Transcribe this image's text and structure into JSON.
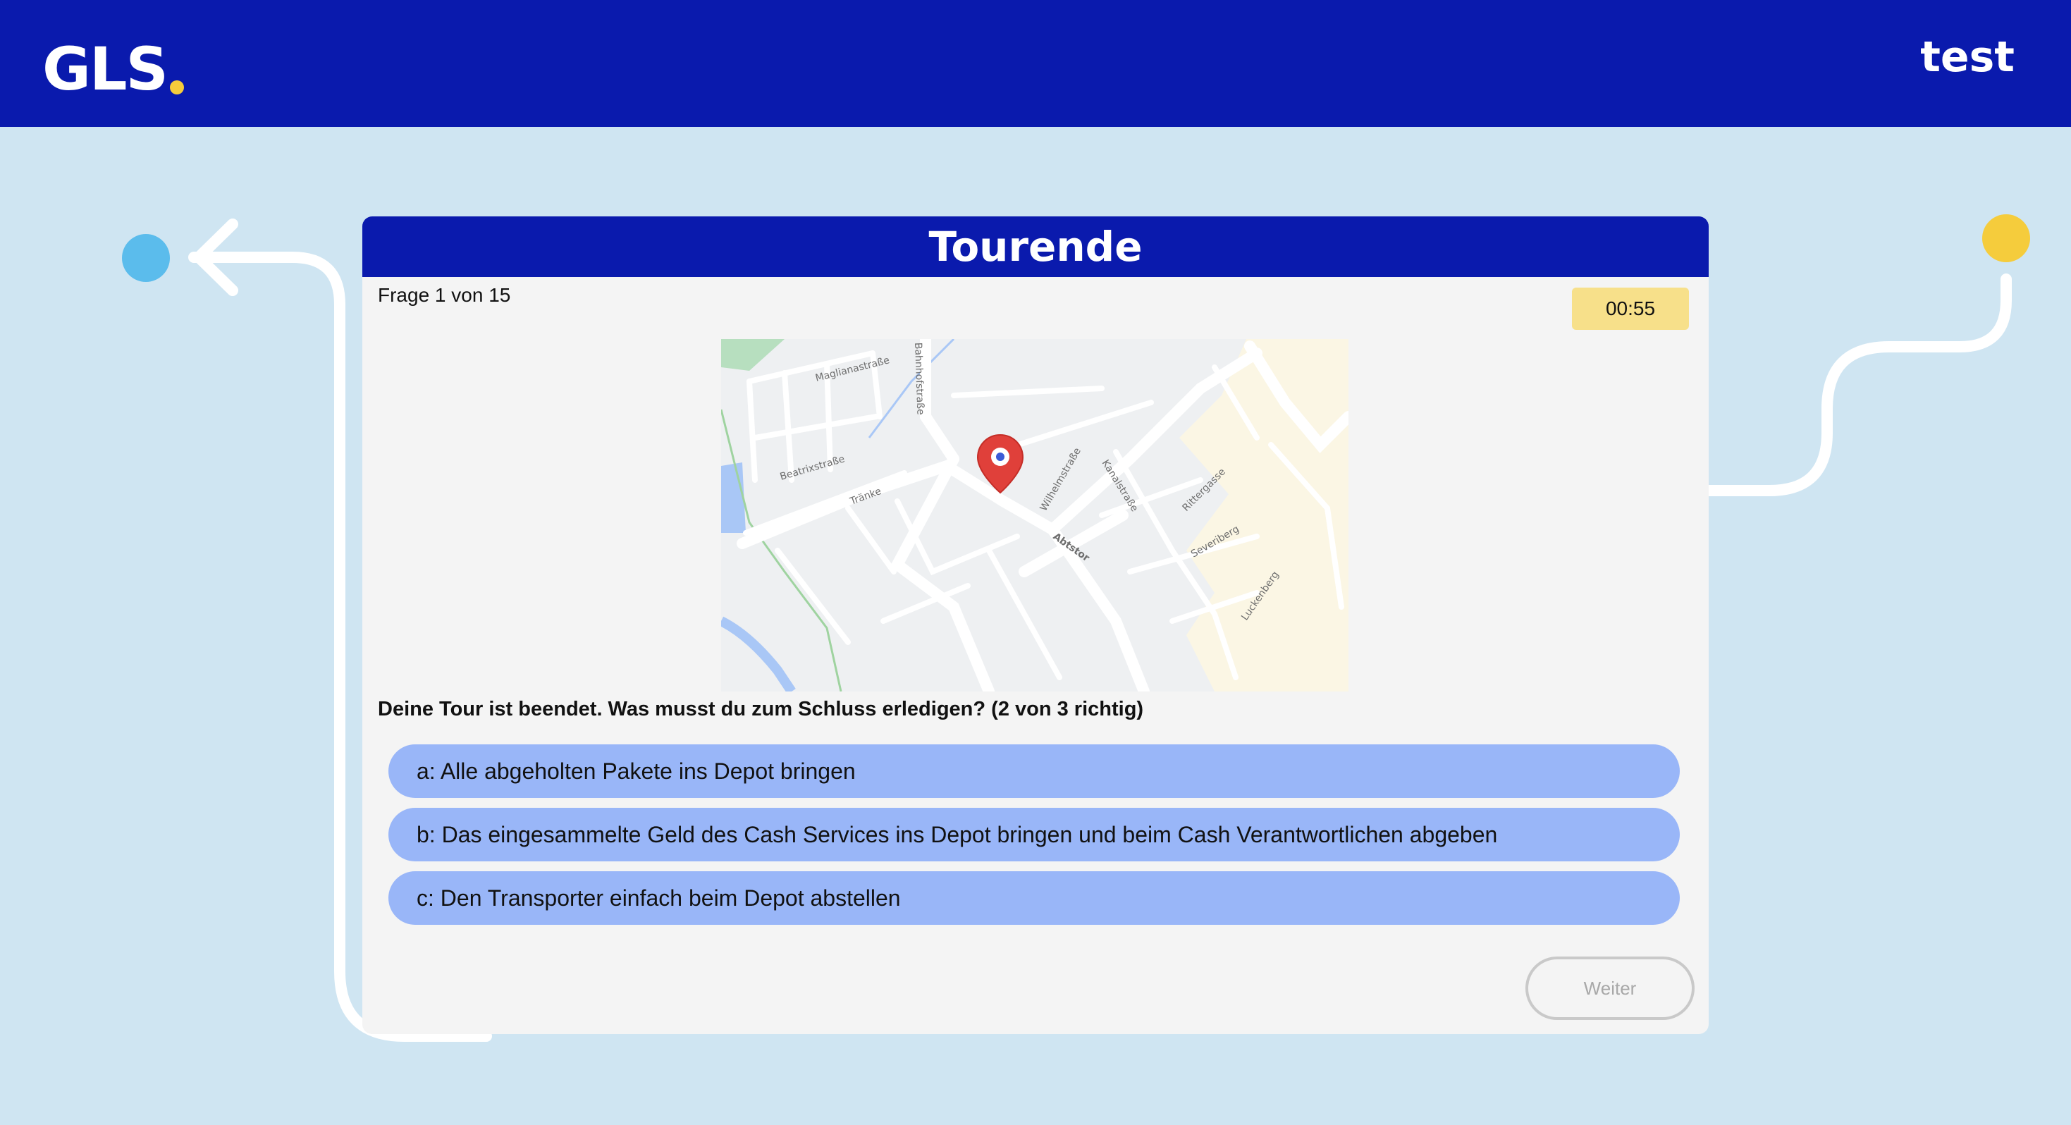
{
  "header": {
    "logo_text": "GLS",
    "user_name": "test",
    "colors": {
      "brand_blue": "#0a1aad",
      "accent_yellow": "#f5cc3c"
    }
  },
  "decor": {
    "start_dot_color": "#5bbcec",
    "end_dot_color": "#f5cc3c",
    "path_icon": "arrow-left-icon"
  },
  "quiz": {
    "title": "Tourende",
    "counter": "Frage 1 von 15",
    "timer": "00:55",
    "question": "Deine Tour ist beendet. Was musst du zum Schluss erledigen? (2 von 3 richtig)",
    "answers": [
      "a: Alle abgeholten Pakete ins Depot bringen",
      "b: Das eingesammelte Geld des Cash Services ins Depot bringen und beim Cash Verantwortlichen abgeben",
      "c: Den Transporter einfach beim Depot abstellen"
    ],
    "next_label": "Weiter"
  },
  "map": {
    "pin_icon": "map-pin-icon",
    "street_labels": [
      "Maglianastraße",
      "Bahnhofstraße",
      "Beatrixstraße",
      "Tränke",
      "Wilhelmstraße",
      "Kanalstraße",
      "Rittergasse",
      "Abtstor",
      "Severiberg",
      "Luckenberg"
    ]
  }
}
